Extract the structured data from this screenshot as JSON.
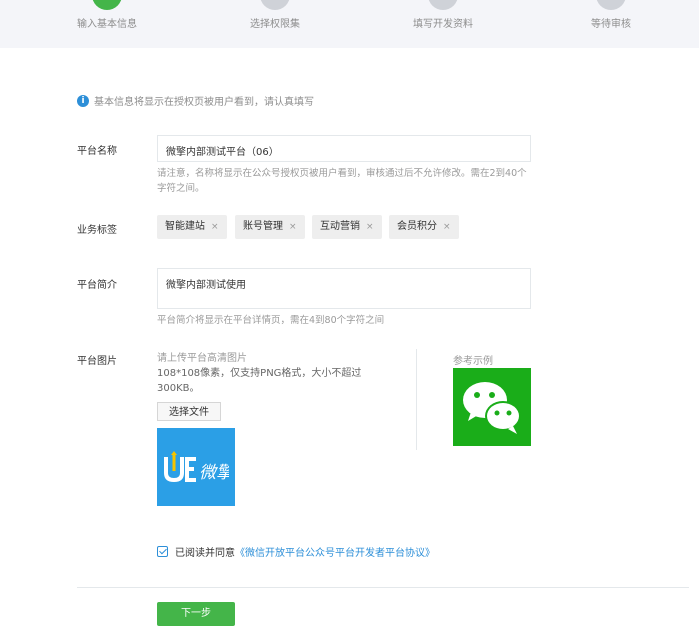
{
  "steps": [
    {
      "label": "输入基本信息",
      "active": true
    },
    {
      "label": "选择权限集",
      "active": false
    },
    {
      "label": "填写开发资料",
      "active": false
    },
    {
      "label": "等待审核",
      "active": false
    }
  ],
  "notice": "基本信息将显示在授权页被用户看到，请认真填写",
  "form": {
    "name": {
      "label": "平台名称",
      "value": "微擎内部测试平台（06）",
      "hint": "请注意，名称将显示在公众号授权页被用户看到，审核通过后不允许修改。需在2到40个字符之间。"
    },
    "tags": {
      "label": "业务标签",
      "items": [
        "智能建站",
        "账号管理",
        "互动营销",
        "会员积分"
      ]
    },
    "intro": {
      "label": "平台简介",
      "value": "微擎内部测试使用",
      "hint": "平台简介将显示在平台详情页，需在4到80个字符之间"
    },
    "image": {
      "label": "平台图片",
      "upload_hint": "请上传平台高清图片",
      "upload_spec": "108*108像素，仅支持PNG格式，大小不超过300KB。",
      "choose_file": "选择文件",
      "preview_logo_text": "微擎",
      "example_label": "参考示例"
    }
  },
  "agreement": {
    "prefix": "已阅读并同意",
    "link": "《微信开放平台公众号平台开发者平台协议》",
    "checked": true
  },
  "next_button": "下一步",
  "colors": {
    "primary_green": "#44b549",
    "link_blue": "#2d8fd8",
    "wechat_green": "#1aad19",
    "logo_blue": "#2b9fe6"
  }
}
